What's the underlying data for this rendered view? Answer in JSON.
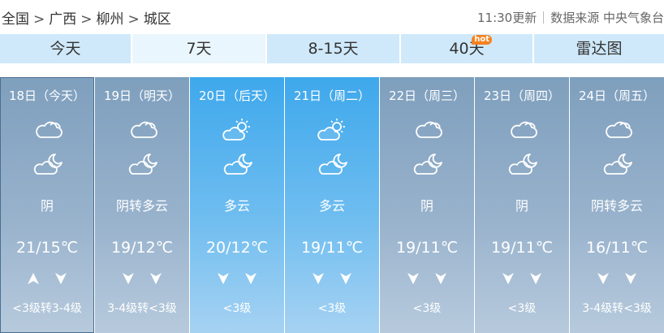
{
  "breadcrumb": [
    "全国",
    "广西",
    "柳州",
    "城区"
  ],
  "header": {
    "updated": "11:30更新",
    "source": "数据来源 中央气象台"
  },
  "tabs": [
    {
      "label": "今天",
      "width": 163
    },
    {
      "label": "7天",
      "active": true,
      "width": 166
    },
    {
      "label": "8-15天",
      "width": 165
    },
    {
      "label": "40天",
      "badge": "hot",
      "width": 164
    },
    {
      "label": "雷达图",
      "width": 160
    }
  ],
  "days": [
    {
      "date": "18日（今天）",
      "icon_day": "cloudy-icon",
      "icon_night": "cloudy-night-icon",
      "weather": "阴",
      "temp": "21/15℃",
      "wind_dir": [
        "up",
        "down"
      ],
      "wind": "<3级转3-4级"
    },
    {
      "date": "19日（明天）",
      "icon_day": "cloudy-icon",
      "icon_night": "cloudy-night-icon",
      "weather": "阴转多云",
      "temp": "19/12℃",
      "wind_dir": [
        "down",
        "down"
      ],
      "wind": "3-4级转<3级"
    },
    {
      "date": "20日（后天）",
      "icon_day": "partly-cloudy-icon",
      "icon_night": "cloudy-night-icon",
      "weather": "多云",
      "temp": "20/12℃",
      "wind_dir": [
        "down",
        "down"
      ],
      "wind": "<3级"
    },
    {
      "date": "21日（周二）",
      "icon_day": "partly-cloudy-icon",
      "icon_night": "cloudy-night-icon",
      "weather": "多云",
      "temp": "19/11℃",
      "wind_dir": [
        "down",
        "down"
      ],
      "wind": "<3级"
    },
    {
      "date": "22日（周三）",
      "icon_day": "cloudy-icon",
      "icon_night": "cloudy-night-icon",
      "weather": "阴",
      "temp": "19/11℃",
      "wind_dir": [
        "down",
        "down"
      ],
      "wind": "<3级"
    },
    {
      "date": "23日（周四）",
      "icon_day": "cloudy-icon",
      "icon_night": "cloudy-night-icon",
      "weather": "阴",
      "temp": "19/11℃",
      "wind_dir": [
        "down",
        "down"
      ],
      "wind": "<3级"
    },
    {
      "date": "24日（周五）",
      "icon_day": "cloudy-icon",
      "icon_night": "cloudy-night-icon",
      "weather": "阴转多云",
      "temp": "16/11℃",
      "wind_dir": [
        "down",
        "down"
      ],
      "wind": "3-4级转<3级"
    }
  ],
  "colors": {
    "tab_bg": "#cfe9fa",
    "tab_active_bg": "#eaf6fd",
    "day_dim": "#8ea9c4",
    "day_sunny": "#4aaeee",
    "hot_badge": "#f5821f"
  }
}
